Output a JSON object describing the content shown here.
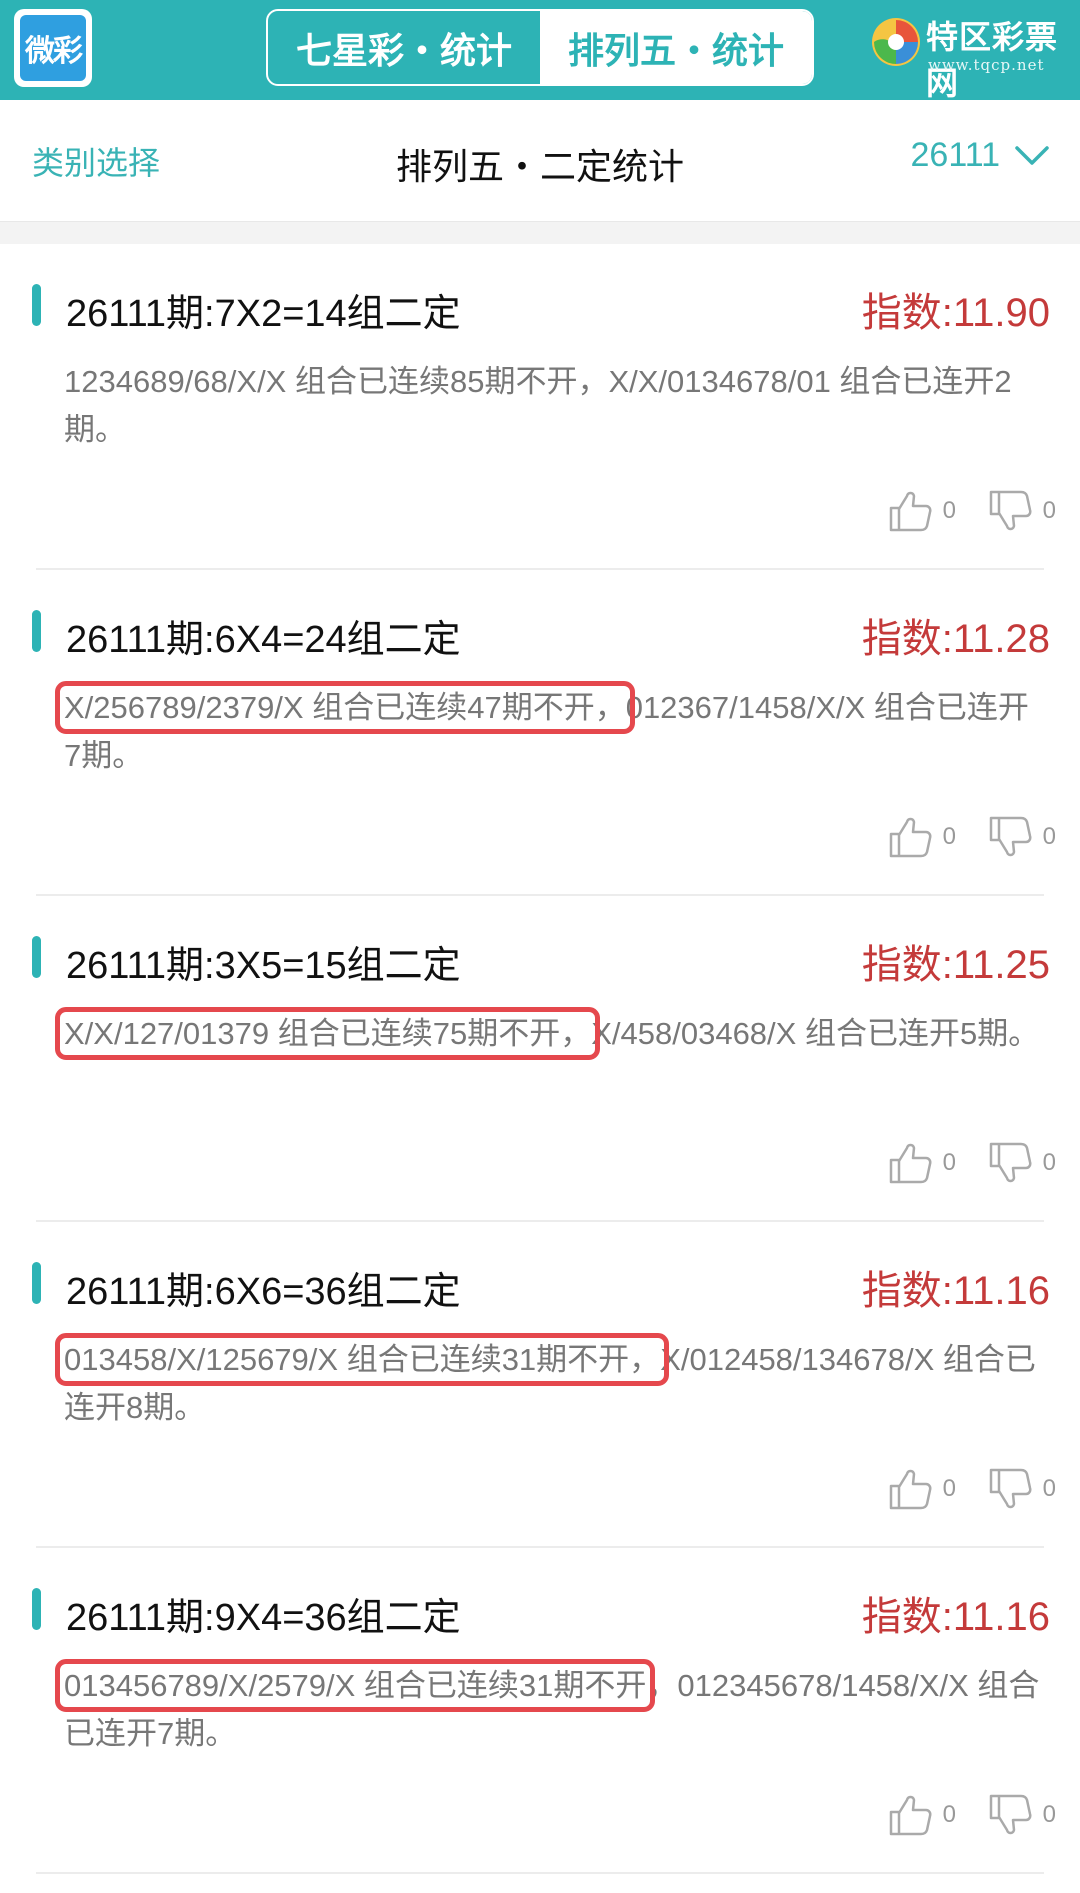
{
  "app": {
    "logo_text": "微彩"
  },
  "top_tabs": [
    {
      "label": "七星彩・统计",
      "active": false
    },
    {
      "label": "排列五・统计",
      "active": true
    }
  ],
  "brand": {
    "name": "特区彩票网",
    "url": "www.tqcp.net"
  },
  "subheader": {
    "category_select": "类别选择",
    "title": "排列五・二定统计",
    "issue": "26111"
  },
  "colors": {
    "accent": "#2db3b5",
    "index_red": "#c43a3a",
    "highlight": "#e5484d"
  },
  "cards": [
    {
      "title": "26111期:7X2=14组二定",
      "index": "指数:11.90",
      "highlight": "",
      "rest": "1234689/68/X/X 组合已连续85期不开，X/X/0134678/01 组合已连开2期。",
      "likes": "0",
      "dislikes": "0"
    },
    {
      "title": "26111期:6X4=24组二定",
      "index": "指数:11.28",
      "highlight": "X/256789/2379/X 组合已连续47期不开，",
      "rest": "012367/1458/X/X 组合已连开7期。",
      "likes": "0",
      "dislikes": "0"
    },
    {
      "title": "26111期:3X5=15组二定",
      "index": "指数:11.25",
      "highlight": "X/X/127/01379 组合已连续75期不开，",
      "rest": "X/458/03468/X 组合已连开5期。",
      "likes": "0",
      "dislikes": "0"
    },
    {
      "title": "26111期:6X6=36组二定",
      "index": "指数:11.16",
      "highlight": "013458/X/125679/X 组合已连续31期不开，",
      "rest": "X/012458/134678/X 组合已连开8期。",
      "likes": "0",
      "dislikes": "0"
    },
    {
      "title": "26111期:9X4=36组二定",
      "index": "指数:11.16",
      "highlight": "013456789/X/2579/X 组合已连续31期不开",
      "rest": "，012345678/1458/X/X 组合已连开7期。",
      "likes": "0",
      "dislikes": "0"
    }
  ]
}
